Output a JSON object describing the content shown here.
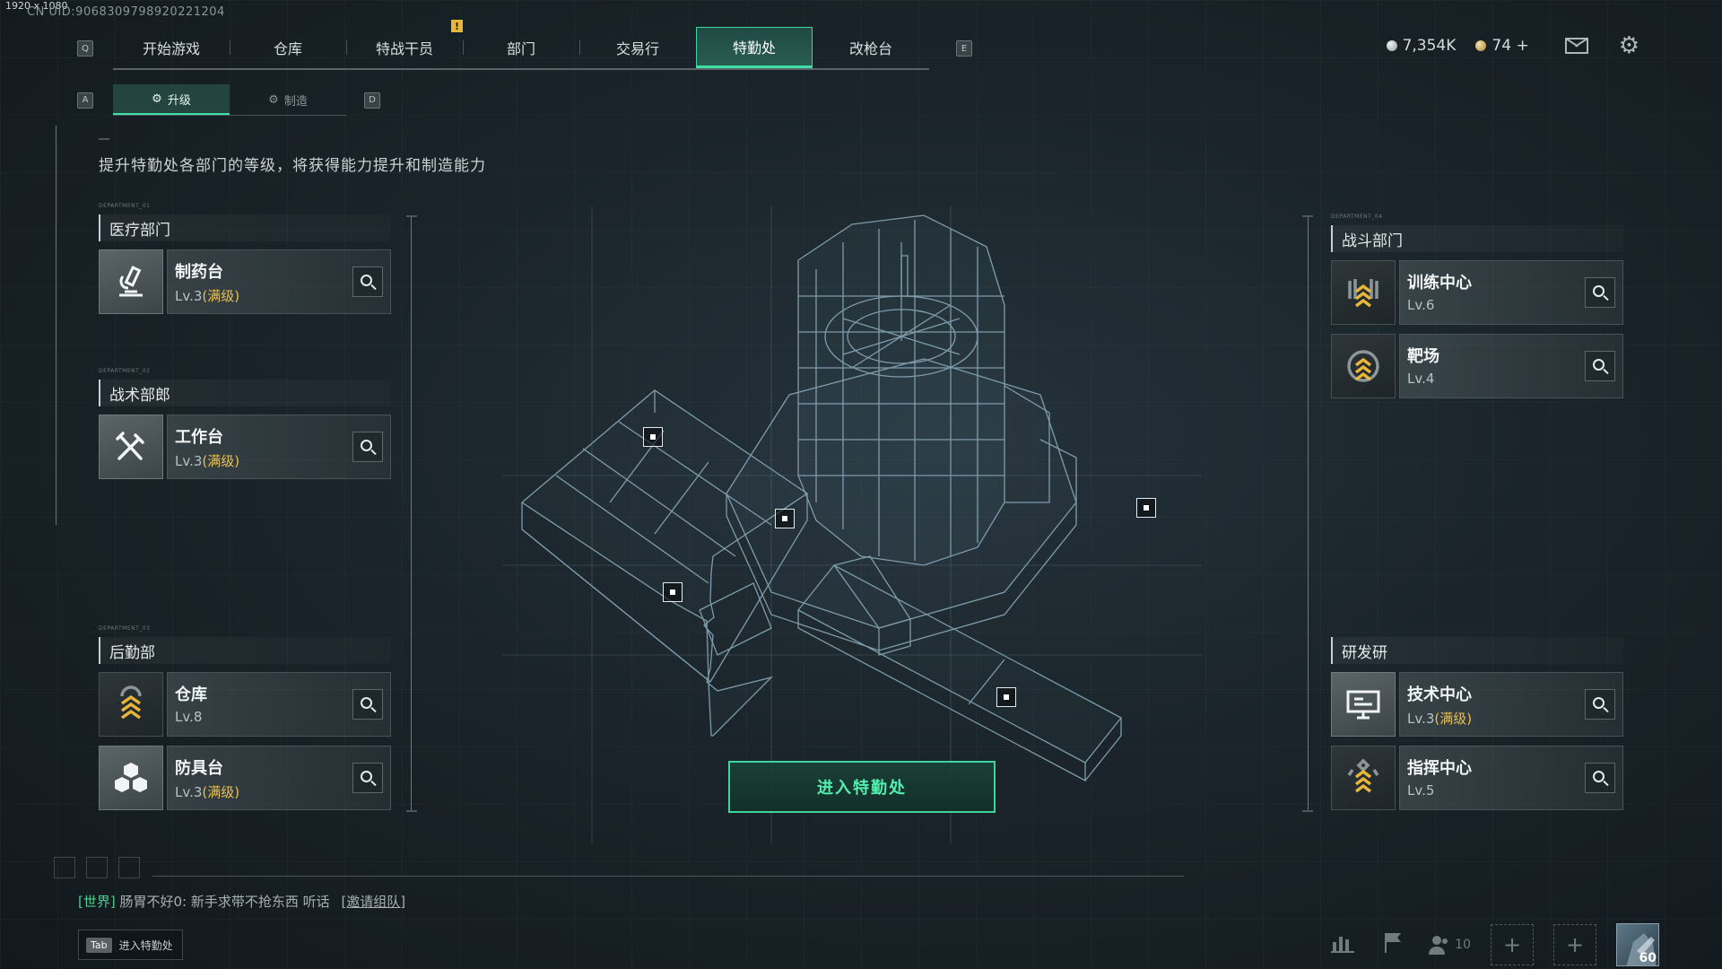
{
  "window": {
    "resolution": "1920 x 1080",
    "uid": "CN UID:9068309798920221204"
  },
  "nav": {
    "left_key": "Q",
    "right_key": "E",
    "tabs": [
      {
        "label": "开始游戏"
      },
      {
        "label": "仓库"
      },
      {
        "label": "特战干员",
        "badge": "!"
      },
      {
        "label": "部门"
      },
      {
        "label": "交易行"
      },
      {
        "label": "特勤处",
        "active": true
      },
      {
        "label": "改枪台"
      }
    ]
  },
  "currency": {
    "silver": "7,354K",
    "gold": "74 +"
  },
  "subnav": {
    "left_key": "A",
    "right_key": "D",
    "tabs": [
      {
        "label": "升级",
        "active": true
      },
      {
        "label": "制造"
      }
    ]
  },
  "description": "提升特勤处各部门的等级，将获得能力提升和制造能力",
  "departments": {
    "medical": {
      "tag": "DEPARTMENT_01",
      "title": "医疗部门",
      "items": [
        {
          "name": "制药台",
          "level": "Lv.3",
          "max_tag": "(满级)",
          "icon": "microscope-icon"
        }
      ]
    },
    "tactical": {
      "tag": "DEPARTMENT_02",
      "title": "战术部郎",
      "items": [
        {
          "name": "工作台",
          "level": "Lv.3",
          "max_tag": "(满级)",
          "icon": "tools-icon"
        }
      ]
    },
    "logistics": {
      "tag": "DEPARTMENT_03",
      "title": "后勤部",
      "items": [
        {
          "name": "仓库",
          "level": "Lv.8",
          "max_tag": "",
          "icon": "rank-chevron-icon"
        },
        {
          "name": "防具台",
          "level": "Lv.3",
          "max_tag": "(满级)",
          "icon": "cubes-icon"
        }
      ]
    },
    "combat": {
      "tag": "DEPARTMENT_04",
      "title": "战斗部门",
      "items": [
        {
          "name": "训练中心",
          "level": "Lv.6",
          "max_tag": "",
          "icon": "rank-chevron-icon"
        },
        {
          "name": "靶场",
          "level": "Lv.4",
          "max_tag": "",
          "icon": "rank-chevron-icon"
        }
      ]
    },
    "research": {
      "tag": "",
      "title": "研发研",
      "items": [
        {
          "name": "技术中心",
          "level": "Lv.3",
          "max_tag": "(满级)",
          "icon": "monitor-icon"
        },
        {
          "name": "指挥中心",
          "level": "Lv.5",
          "max_tag": "",
          "icon": "rank-chevron-icon"
        }
      ]
    }
  },
  "enter_button": "进入特勤处",
  "chat": {
    "channel": "[世界]",
    "user": "肠胃不好0:",
    "message": "新手求带不抢东西 听话",
    "invite": "[邀请组队]"
  },
  "tab_hint": {
    "key": "Tab",
    "label": "进入特勤处"
  },
  "bottom_bar": {
    "friends_count": "10",
    "player_level": "60"
  },
  "colors": {
    "accent": "#3fe0a8",
    "max_level": "#e9bf55",
    "badge": "#e8b73a"
  }
}
